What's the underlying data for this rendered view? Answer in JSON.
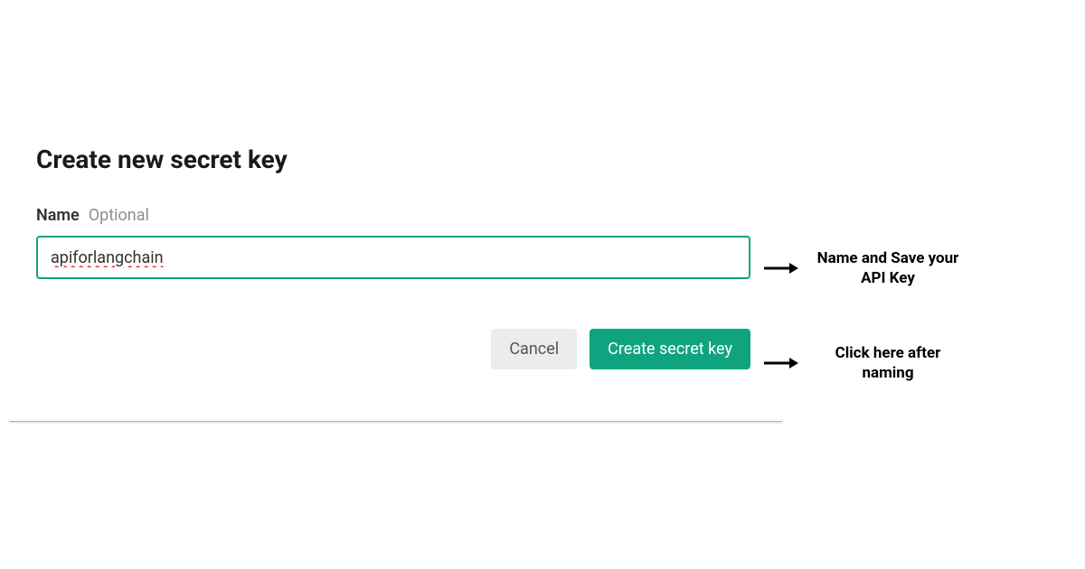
{
  "dialog": {
    "title": "Create new secret key",
    "field": {
      "label": "Name",
      "optional_text": "Optional",
      "value": "apiforlangchain"
    },
    "buttons": {
      "cancel": "Cancel",
      "create": "Create secret key"
    }
  },
  "annotations": {
    "input_note": "Name and Save your API Key",
    "button_note": "Click here after naming"
  },
  "colors": {
    "primary": "#10a37f",
    "cancel_bg": "#ececec"
  }
}
